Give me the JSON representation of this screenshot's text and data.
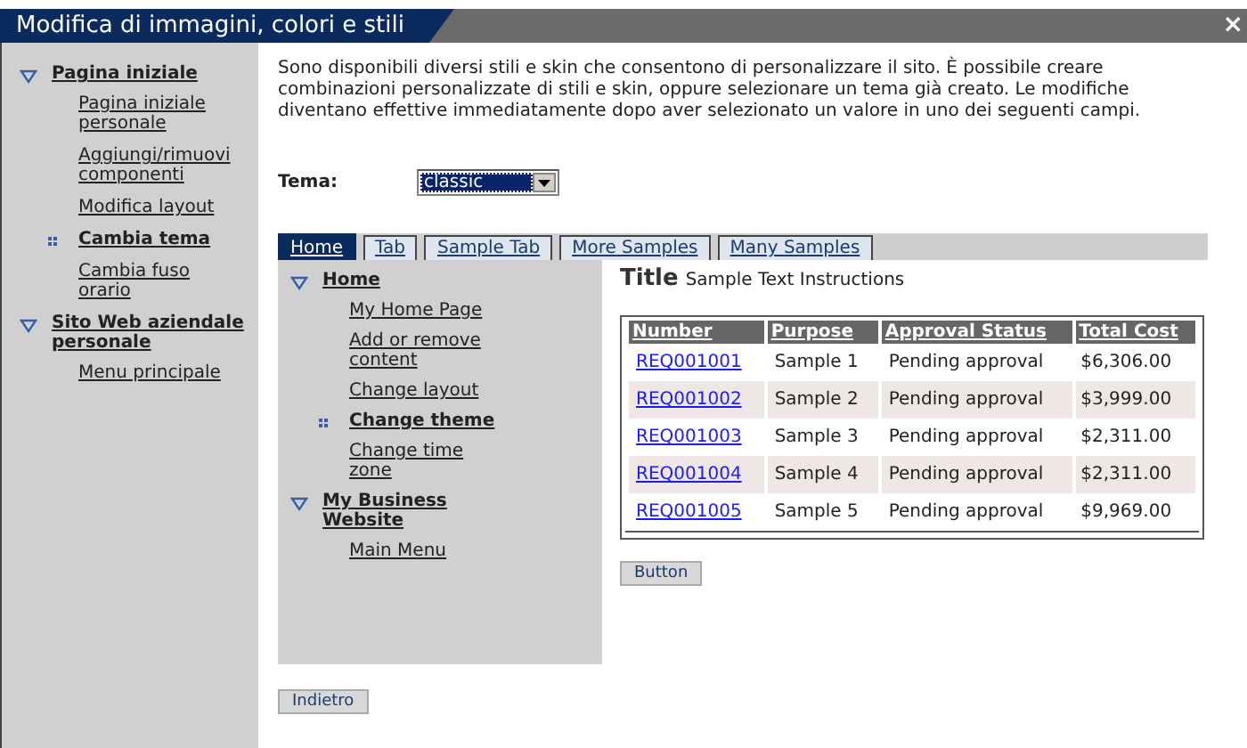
{
  "window": {
    "title": "Modifica di immagini, colori e stili",
    "close": "×"
  },
  "sidebar": {
    "items": [
      {
        "label": "Pagina iniziale",
        "expanded": true,
        "children": [
          {
            "label": "Pagina iniziale personale",
            "selected": false
          },
          {
            "label": "Aggiungi/rimuovi componenti",
            "selected": false
          },
          {
            "label": "Modifica layout",
            "selected": false
          },
          {
            "label": "Cambia tema",
            "selected": true
          },
          {
            "label": "Cambia fuso orario",
            "selected": false
          }
        ]
      },
      {
        "label": "Sito Web aziendale personale",
        "expanded": true,
        "children": [
          {
            "label": "Menu principale",
            "selected": false
          }
        ]
      }
    ]
  },
  "description": "Sono disponibili diversi stili e skin che consentono di personalizzare il sito. È possibile creare combinazioni personalizzate di stili e skin, oppure selezionare un tema già creato. Le modifiche diventano effettive immediatamente dopo aver selezionato un valore in uno dei seguenti campi.",
  "theme": {
    "label": "Tema:",
    "value": "classic"
  },
  "preview": {
    "tabs": [
      {
        "label": "Home",
        "selected": true
      },
      {
        "label": "Tab",
        "selected": false
      },
      {
        "label": "Sample Tab",
        "selected": false
      },
      {
        "label": "More Samples",
        "selected": false
      },
      {
        "label": "Many Samples",
        "selected": false
      }
    ],
    "nav": {
      "items": [
        {
          "label": "Home",
          "expanded": true,
          "children": [
            {
              "label": "My Home Page",
              "selected": false
            },
            {
              "label": "Add or remove content",
              "selected": false
            },
            {
              "label": "Change layout",
              "selected": false
            },
            {
              "label": "Change theme",
              "selected": true
            },
            {
              "label": "Change time zone",
              "selected": false
            }
          ]
        },
        {
          "label": "My Business Website",
          "expanded": true,
          "children": [
            {
              "label": "Main Menu",
              "selected": false
            }
          ]
        }
      ]
    },
    "title": "Title",
    "instructions": "Sample Text Instructions",
    "table": {
      "columns": [
        "Number",
        "Purpose",
        "Approval Status",
        "Total Cost"
      ],
      "rows": [
        [
          "REQ001001",
          "Sample 1",
          "Pending approval",
          "$6,306.00"
        ],
        [
          "REQ001002",
          "Sample 2",
          "Pending approval",
          "$3,999.00"
        ],
        [
          "REQ001003",
          "Sample 3",
          "Pending approval",
          "$2,311.00"
        ],
        [
          "REQ001004",
          "Sample 4",
          "Pending approval",
          "$2,311.00"
        ],
        [
          "REQ001005",
          "Sample 5",
          "Pending approval",
          "$9,969.00"
        ]
      ]
    },
    "button": "Button"
  },
  "back_button": "Indietro"
}
